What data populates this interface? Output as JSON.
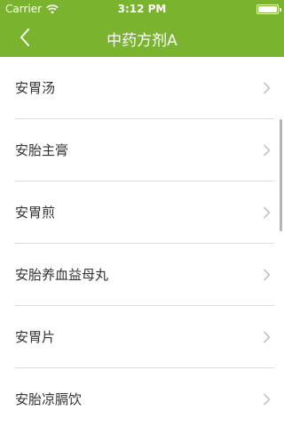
{
  "status_bar": {
    "carrier": "Carrier",
    "time": "3:12 PM"
  },
  "nav": {
    "title": "中药方剂A",
    "back_icon": "chevron-left-icon"
  },
  "colors": {
    "header_bg": "#7ab32e",
    "text": "#333333",
    "separator": "#dcdcdc",
    "chevron": "#bdbdbd"
  },
  "list": {
    "items": [
      {
        "label": "安胃汤"
      },
      {
        "label": "安胎主膏"
      },
      {
        "label": "安胃煎"
      },
      {
        "label": "安胎养血益母丸"
      },
      {
        "label": "安胃片"
      },
      {
        "label": "安胎凉膈饮"
      }
    ]
  }
}
